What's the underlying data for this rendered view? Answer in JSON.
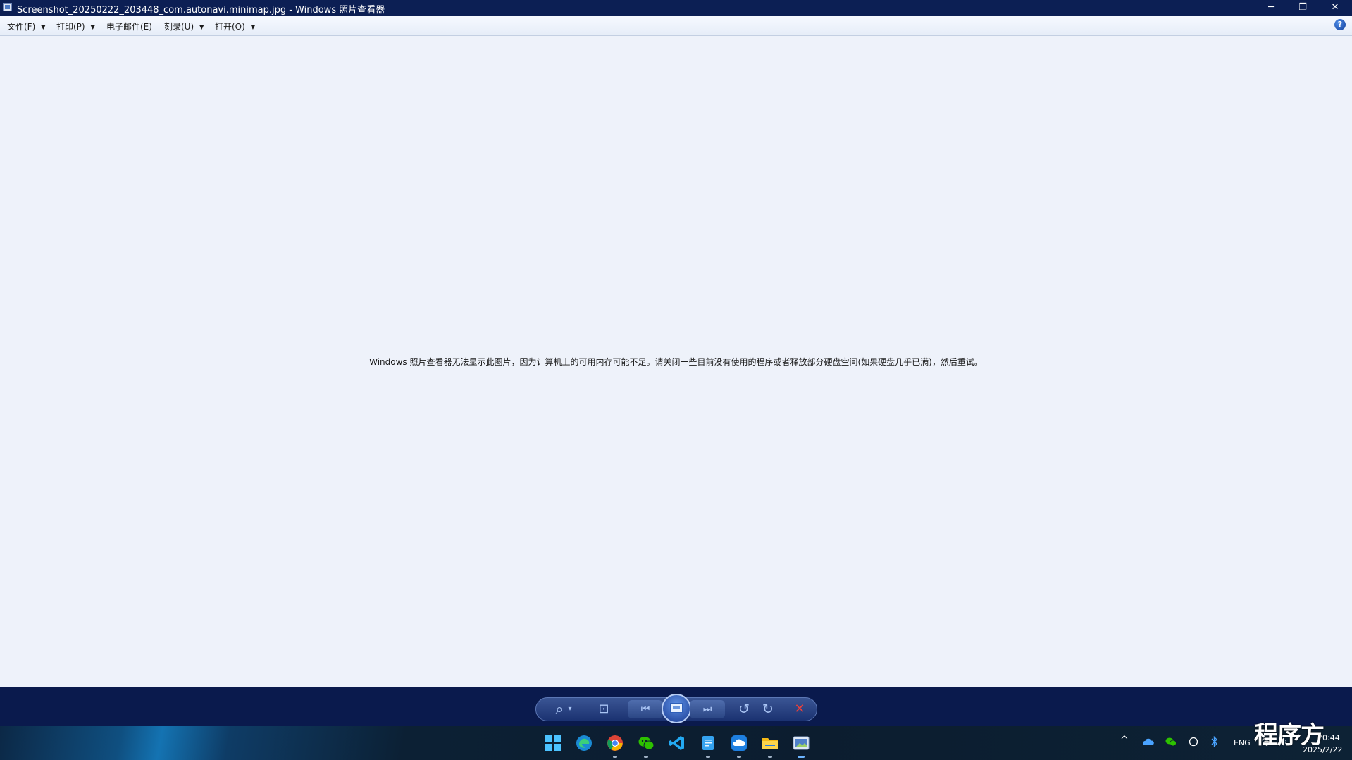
{
  "window": {
    "title": "Screenshot_20250222_203448_com.autonavi.minimap.jpg - Windows 照片查看器",
    "minimize": "─",
    "restore": "❐",
    "close": "✕"
  },
  "menubar": {
    "items": [
      {
        "label": "文件(F)",
        "has_dropdown": true
      },
      {
        "label": "打印(P)",
        "has_dropdown": true
      },
      {
        "label": "电子邮件(E)",
        "has_dropdown": false
      },
      {
        "label": "刻录(U)",
        "has_dropdown": true
      },
      {
        "label": "打开(O)",
        "has_dropdown": true
      }
    ],
    "dropdown_glyph": "▼",
    "help": "?"
  },
  "viewer": {
    "message": "Windows 照片查看器无法显示此图片，因为计算机上的可用内存可能不足。请关闭一些目前没有使用的程序或者释放部分硬盘空间(如果硬盘几乎已满)，然后重试。"
  },
  "controls": {
    "zoom": "⌕",
    "zoom_dropdown": "▾",
    "actual_size": "⊡",
    "previous": "⏮",
    "next": "⏭",
    "rotate_ccw": "↺",
    "rotate_cw": "↻",
    "delete": "✕",
    "delete_color": "#e8403b"
  },
  "taskbar": {
    "apps": [
      "start-icon",
      "edge-icon",
      "chrome-icon",
      "wechat-icon",
      "vscode-icon",
      "notepad-icon",
      "cloud-icon",
      "file-explorer-icon",
      "photo-viewer-icon"
    ],
    "tray": {
      "chevron": "^",
      "language": "ENG",
      "time": "20:44",
      "date": "2025/2/22"
    }
  },
  "watermark": "程序方"
}
